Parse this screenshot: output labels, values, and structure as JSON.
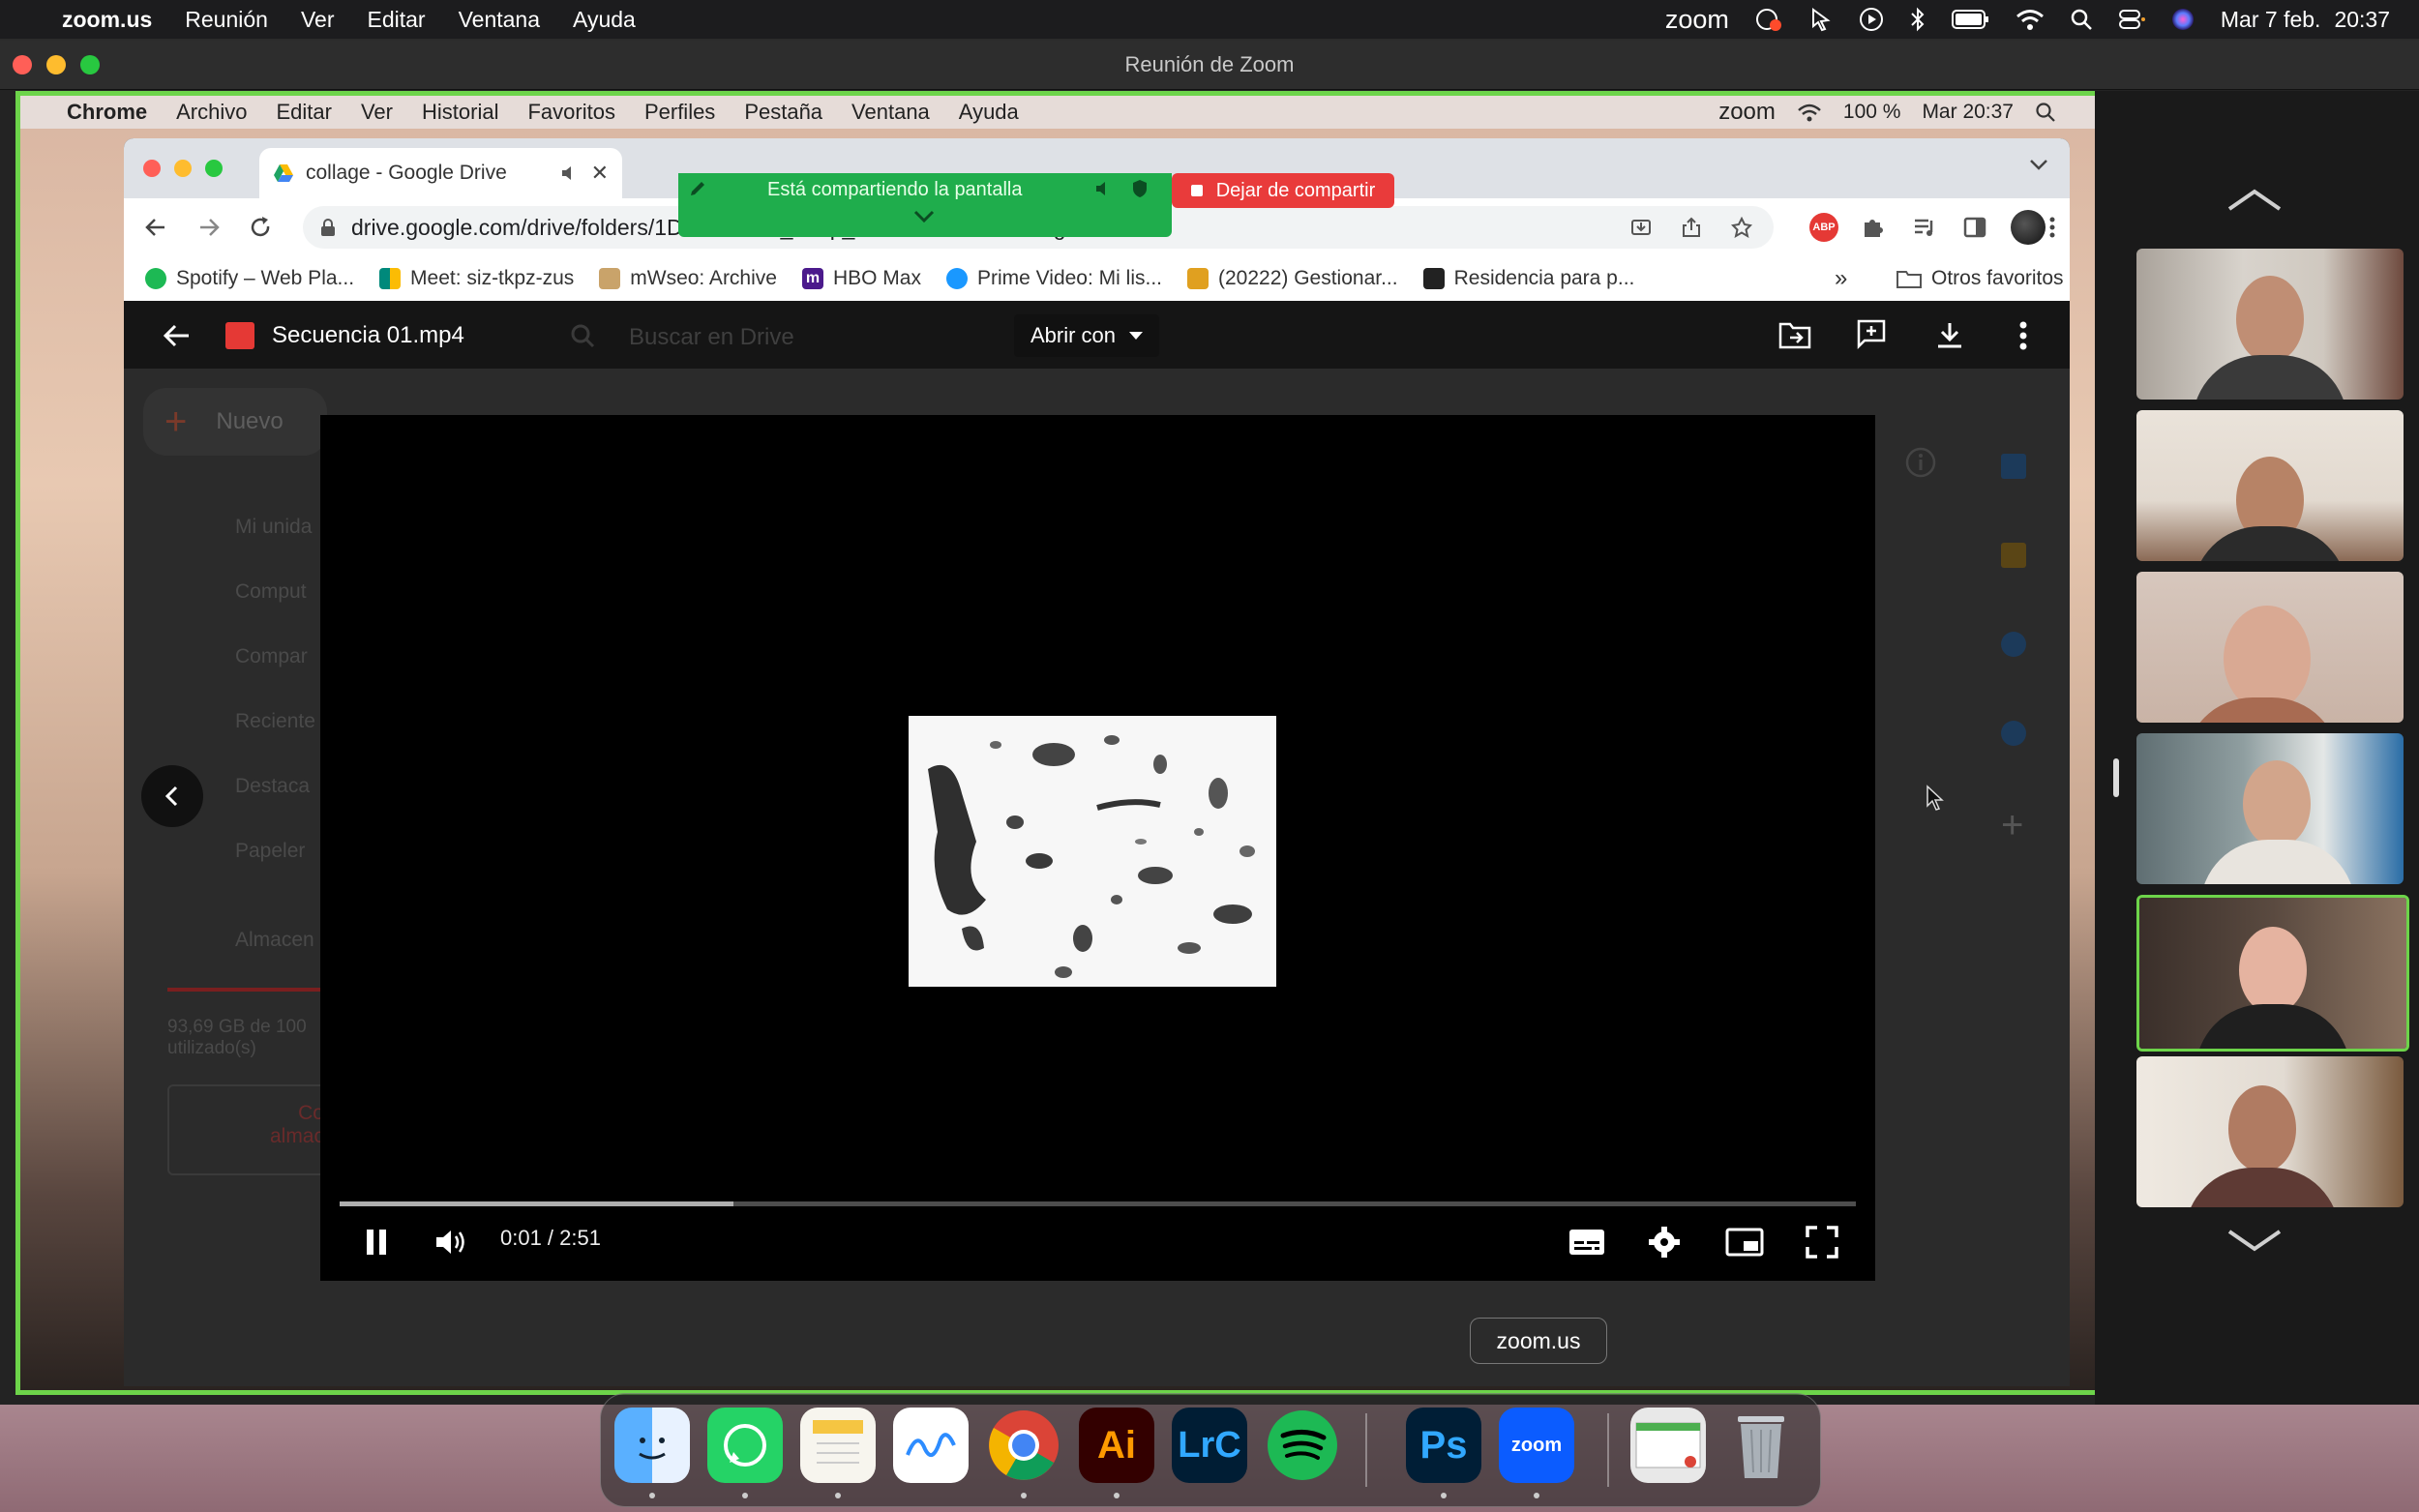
{
  "mac_menubar": {
    "app": "zoom.us",
    "items": [
      "Reunión",
      "Ver",
      "Editar",
      "Ventana",
      "Ayuda"
    ],
    "zoom_logo_text": "zoom",
    "date": "Mar 7 feb.",
    "time": "20:37"
  },
  "zoom_window": {
    "title": "Reunión de Zoom"
  },
  "inner_menubar": {
    "app": "Chrome",
    "items": [
      "Archivo",
      "Editar",
      "Ver",
      "Historial",
      "Favoritos",
      "Perfiles",
      "Pestaña",
      "Ventana",
      "Ayuda"
    ],
    "zoom_logo_text": "zoom",
    "battery": "100 %",
    "datetime": "Mar 20:37"
  },
  "share_banner": {
    "status": "Está compartiendo la pantalla",
    "stop_label": "Dejar de compartir"
  },
  "chrome": {
    "tab_title": "collage - Google Drive",
    "url": "drive.google.com/drive/folders/1D9TfT30nE_hb0p_Ev7LVYYJGY7Z7s0g9",
    "bookmarks": [
      {
        "label": "Spotify – Web Pla...",
        "color": "#1db954"
      },
      {
        "label": "Meet: siz-tkpz-zus",
        "color": "#00897b"
      },
      {
        "label": "mWseo: Archive",
        "color": "#c9a36a"
      },
      {
        "label": "HBO Max",
        "color": "#4b1a8c"
      },
      {
        "label": "Prime Video: Mi lis...",
        "color": "#1a98ff"
      },
      {
        "label": "(20222) Gestionar...",
        "color": "#e0a020"
      },
      {
        "label": "Residencia para p...",
        "color": "#222222"
      }
    ],
    "bookmarks_more": "»",
    "other_bookmarks": "Otros favoritos"
  },
  "drive": {
    "file_name": "Secuencia 01.mp4",
    "open_with": "Abrir con",
    "search_placeholder": "Buscar en Drive",
    "new_label": "Nuevo",
    "sidebar": [
      "Mi unida",
      "Comput",
      "Compar",
      "Reciente",
      "Destaca",
      "Papeler"
    ],
    "storage_label": "Almacen",
    "storage_used": "93,69 GB de 100",
    "storage_used2": "utilizado(s)",
    "storage_button": "Co",
    "storage_button2": "almac"
  },
  "player": {
    "time": "0:01 / 2:51",
    "progress": 0.26
  },
  "dock": {
    "tooltip": "zoom.us",
    "apps": [
      {
        "name": "Finder",
        "color": "#2f8df5"
      },
      {
        "name": "WhatsApp",
        "color": "#25d366"
      },
      {
        "name": "Notas",
        "color": "#f5f5f0"
      },
      {
        "name": "Freeform",
        "color": "#ffffff"
      },
      {
        "name": "Chrome",
        "color": "#ffffff"
      },
      {
        "name": "Illustrator",
        "label": "Ai",
        "color": "#330000"
      },
      {
        "name": "Lightroom Classic",
        "label": "LrC",
        "color": "#001d34"
      },
      {
        "name": "Spotify",
        "color": "#1db954"
      },
      {
        "name": "Photoshop",
        "label": "Ps",
        "color": "#001e36"
      },
      {
        "name": "Zoom",
        "label": "zoom",
        "color": "#0b5cff"
      }
    ]
  },
  "colors": {
    "share_border": "#6dd44a",
    "banner": "#1fad4c",
    "stop": "#e93b3b",
    "active_speaker": "#6dd44a"
  }
}
